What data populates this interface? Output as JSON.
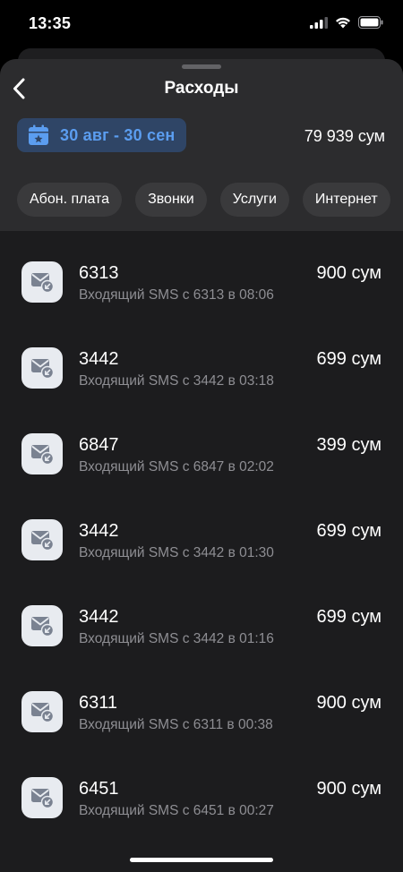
{
  "status_bar": {
    "time": "13:35",
    "icons": [
      "signal-icon",
      "wifi-icon",
      "battery-icon"
    ]
  },
  "header": {
    "title": "Расходы",
    "back_icon": "chevron-left-icon"
  },
  "period": {
    "label": "30 авг - 30 сен",
    "icon": "calendar-icon",
    "total": "79 939 сум"
  },
  "filters": [
    "Абон. плата",
    "Звонки",
    "Услуги",
    "Интернет"
  ],
  "transactions": [
    {
      "title": "6313",
      "subtitle": "Входящий SMS с 6313 в 08:06",
      "amount": "900 сум"
    },
    {
      "title": "3442",
      "subtitle": "Входящий SMS с 3442 в 03:18",
      "amount": "699 сум"
    },
    {
      "title": "6847",
      "subtitle": "Входящий SMS с 6847 в 02:02",
      "amount": "399 сум"
    },
    {
      "title": "3442",
      "subtitle": "Входящий SMS с 3442 в 01:30",
      "amount": "699 сум"
    },
    {
      "title": "3442",
      "subtitle": "Входящий SMS с 3442 в 01:16",
      "amount": "699 сум"
    },
    {
      "title": "6311",
      "subtitle": "Входящий SMS с 6311 в 00:38",
      "amount": "900 сум"
    },
    {
      "title": "6451",
      "subtitle": "Входящий SMS с 6451 в 00:27",
      "amount": "900 сум"
    }
  ],
  "colors": {
    "background": "#000000",
    "sheet": "#1c1c1e",
    "header_area": "#2c2c2e",
    "accent": "#5b9df0",
    "chip": "#3a3a3c",
    "date_chip": "#2f4566",
    "muted_text": "#8e8e93"
  }
}
